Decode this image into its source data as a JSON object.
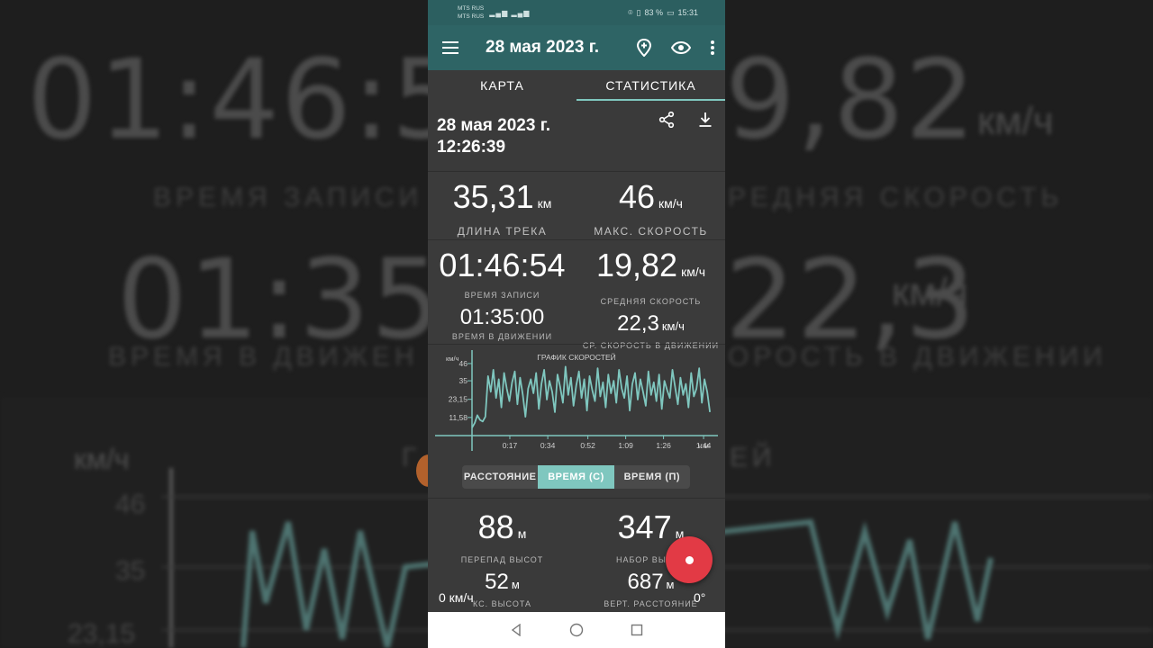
{
  "background": {
    "record_time": "01:46:5",
    "avg_speed": "9,82",
    "speed_unit": "км/ч",
    "label_left": "ВРЕМЯ ЗАПИСИ",
    "label_right": "РЕДНЯЯ СКОРОСТЬ",
    "moving_time": "01:35:00",
    "moving_speed": "22,3",
    "label_moving": "ВРЕМЯ В ДВИЖЕН",
    "label_moving_right": "ОРОСТЬ В ДВИЖЕНИИ",
    "chart_unit": "км/ч",
    "chart_title": "Г",
    "chart_title_right": "ЕЙ",
    "ticks": [
      "46",
      "35",
      "23,15"
    ]
  },
  "status_bar": {
    "operator_1": "MTS RUS",
    "operator_2": "MTS RUS",
    "battery": "83 %",
    "time": "15:31"
  },
  "app_bar": {
    "title": "28 мая 2023 г."
  },
  "tabs": [
    {
      "label": "КАРТА"
    },
    {
      "label": "СТАТИСТИКА"
    }
  ],
  "track": {
    "date": "28 мая 2023 г.",
    "time": "12:26:39"
  },
  "stats": {
    "length_value": "35,31",
    "length_unit": "км",
    "length_label": "ДЛИНА ТРЕКА",
    "max_speed_value": "46",
    "max_speed_unit": "км/ч",
    "max_speed_label": "МАКС. СКОРОСТЬ",
    "record_time_value": "01:46:54",
    "record_time_label": "ВРЕМЯ ЗАПИСИ",
    "avg_speed_value": "19,82",
    "avg_speed_unit": "км/ч",
    "avg_speed_label": "СРЕДНЯЯ СКОРОСТЬ",
    "moving_time_value": "01:35:00",
    "moving_time_label": "ВРЕМЯ В ДВИЖЕНИИ",
    "moving_speed_value": "22,3",
    "moving_speed_unit": "км/ч",
    "moving_speed_label": "СР. СКОРОСТЬ В ДВИЖЕНИИ"
  },
  "chart_data": {
    "type": "line",
    "title": "ГРАФИК СКОРОСТЕЙ",
    "ylabel": "км/ч",
    "xlabel": "ч:м",
    "y_ticks": [
      "46",
      "35",
      "23,15",
      "11,58"
    ],
    "x_ticks": [
      "0:17",
      "0:34",
      "0:52",
      "1:09",
      "1:26",
      "1:44"
    ],
    "ylim": [
      0,
      50
    ],
    "xlim": [
      0,
      1.82
    ],
    "color": "#7fc7bf",
    "series": [
      {
        "x": [
          0,
          0.02,
          0.04,
          0.06,
          0.08,
          0.1,
          0.12,
          0.14,
          0.16,
          0.18,
          0.2,
          0.22,
          0.24,
          0.26,
          0.28,
          0.3,
          0.32,
          0.34,
          0.36,
          0.38,
          0.4,
          0.42,
          0.44,
          0.46,
          0.48,
          0.5,
          0.52,
          0.54,
          0.56,
          0.58,
          0.6,
          0.62,
          0.64,
          0.66,
          0.68,
          0.7,
          0.72,
          0.74,
          0.76,
          0.78,
          0.8,
          0.82,
          0.84,
          0.86,
          0.88,
          0.9,
          0.92,
          0.94,
          0.96,
          0.98,
          1.0,
          1.02,
          1.04,
          1.06,
          1.08,
          1.1,
          1.12,
          1.14,
          1.16,
          1.18,
          1.2,
          1.22,
          1.24,
          1.26,
          1.28,
          1.3,
          1.32,
          1.34,
          1.36,
          1.38,
          1.4,
          1.42,
          1.44,
          1.46,
          1.48,
          1.5,
          1.52,
          1.54,
          1.56,
          1.58,
          1.6,
          1.62,
          1.64,
          1.66,
          1.68,
          1.7,
          1.72,
          1.74,
          1.76,
          1.78
        ],
        "y": [
          5,
          8,
          13,
          10,
          9,
          12,
          38,
          28,
          42,
          24,
          36,
          18,
          40,
          30,
          22,
          34,
          41,
          20,
          37,
          26,
          12,
          30,
          36,
          27,
          40,
          17,
          33,
          42,
          23,
          35,
          28,
          15,
          39,
          31,
          21,
          44,
          26,
          37,
          19,
          32,
          41,
          24,
          36,
          16,
          38,
          29,
          22,
          43,
          25,
          34,
          18,
          39,
          27,
          35,
          21,
          42,
          30,
          24,
          38,
          16,
          33,
          40,
          23,
          36,
          28,
          19,
          41,
          26,
          34,
          22,
          39,
          17,
          35,
          29,
          24,
          42,
          31,
          20,
          37,
          26,
          33,
          18,
          40,
          25,
          30,
          43,
          21,
          36,
          28,
          15
        ]
      }
    ]
  },
  "view_toggle": {
    "distance": "РАССТОЯНИЕ",
    "time_c": "ВРЕМЯ (С)",
    "time_p": "ВРЕМЯ (П)"
  },
  "altitude": {
    "diff_value": "88",
    "diff_unit": "м",
    "diff_label": "ПЕРЕПАД ВЫСОТ",
    "gain_value": "347",
    "gain_unit": "м",
    "gain_label": "НАБОР ВЫС",
    "max_alt_value": "52",
    "max_alt_unit": "м",
    "max_alt_label": "КС. ВЫСОТА",
    "vert_value": "687",
    "vert_unit": "м",
    "vert_label": "ВЕРТ. РАССТОЯНИЕ",
    "speed_overlay": "0 км/ч",
    "angle_overlay": "0°"
  }
}
